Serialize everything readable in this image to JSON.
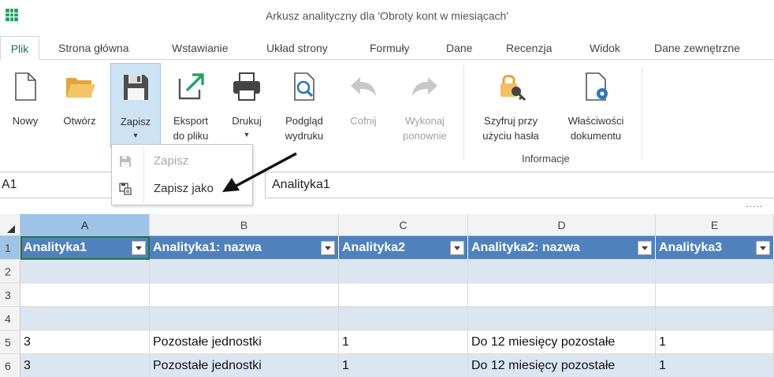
{
  "window": {
    "title": "Arkusz analityczny dla 'Obroty kont w miesiącach'"
  },
  "tabs": [
    "Plik",
    "Strona główna",
    "Wstawianie",
    "Układ strony",
    "Formuły",
    "Dane",
    "Recenzja",
    "Widok",
    "Dane zewnętrzne"
  ],
  "ribbon": {
    "new": "Nowy",
    "open": "Otwórz",
    "save": "Zapisz",
    "export_1": "Eksport",
    "export_2": "do pliku",
    "print": "Drukuj",
    "preview_1": "Podgląd",
    "preview_2": "wydruku",
    "undo": "Cofnij",
    "redo_1": "Wykonaj",
    "redo_2": "ponownie",
    "encrypt_1": "Szyfruj przy",
    "encrypt_2": "użyciu hasła",
    "props_1": "Właściwości",
    "props_2": "dokumentu",
    "group_info": "Informacje"
  },
  "save_menu": {
    "save": "Zapisz",
    "save_as": "Zapisz jako"
  },
  "formula_bar": {
    "cell_ref": "A1",
    "content": "Analityka1",
    "overflow": "....."
  },
  "grid": {
    "columns": [
      "A",
      "B",
      "C",
      "D",
      "E"
    ],
    "header_row": [
      "Analityka1",
      "Analityka1: nazwa",
      "Analityka2",
      "Analityka2: nazwa",
      "Analityka3"
    ],
    "rows": [
      {
        "num": "1"
      },
      {
        "num": "2",
        "cells": [
          "",
          "",
          "",
          "",
          ""
        ]
      },
      {
        "num": "3",
        "cells": [
          "",
          "",
          "",
          "",
          ""
        ]
      },
      {
        "num": "4",
        "cells": [
          "",
          "",
          "",
          "",
          ""
        ]
      },
      {
        "num": "5",
        "cells": [
          "3",
          "Pozostałe jednostki",
          "1",
          "Do 12 miesięcy pozostałe",
          "1"
        ]
      },
      {
        "num": "6",
        "cells": [
          "3",
          "Pozostałe jednostki",
          "1",
          "Do 12 miesięcy pozostałe",
          "1"
        ]
      }
    ]
  },
  "colors": {
    "accent": "#217346",
    "table_header": "#4f81bd",
    "band": "#dce6f1",
    "selected_button": "#cde3f4"
  }
}
